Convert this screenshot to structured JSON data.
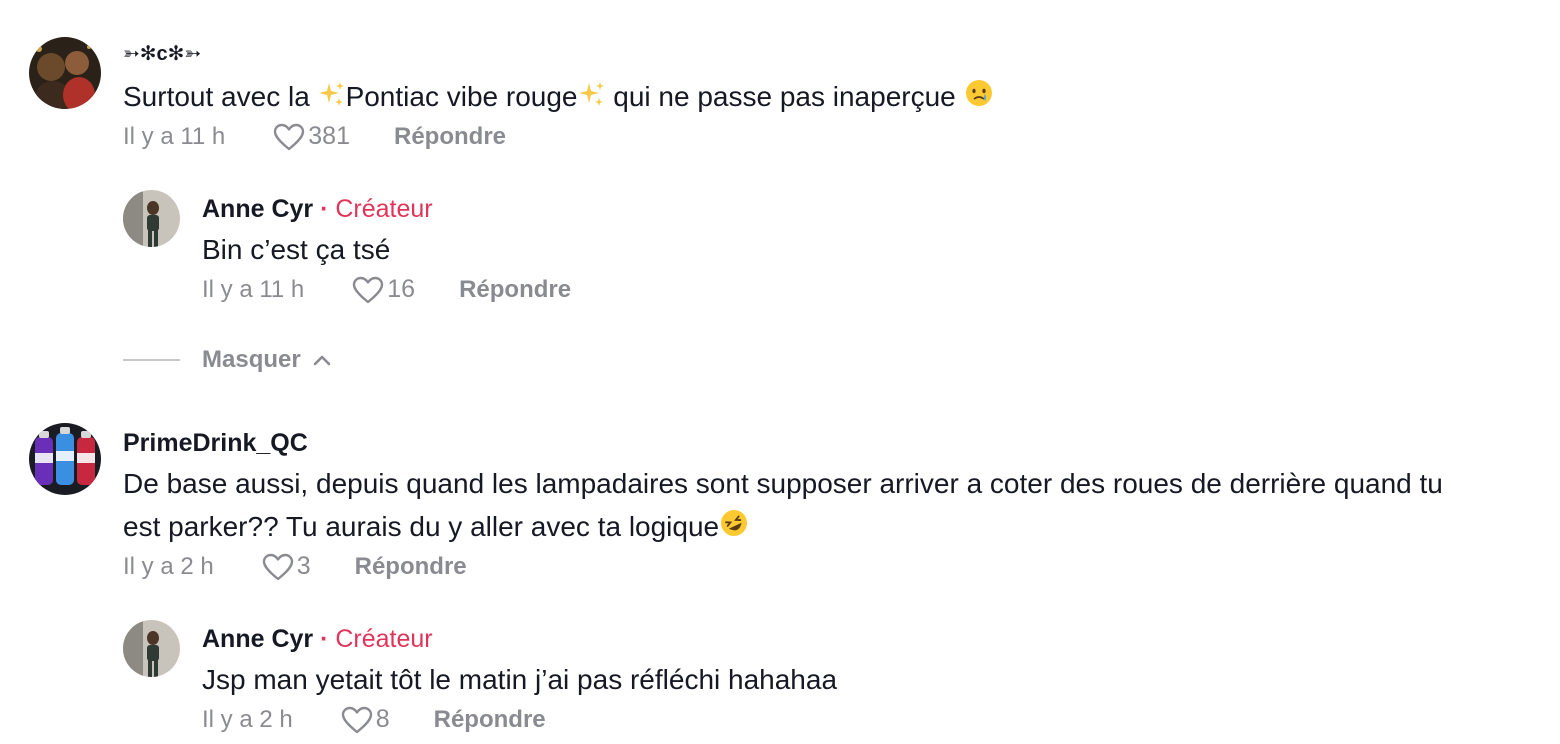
{
  "comments": [
    {
      "username": "➳✻c✻➳",
      "text_before": "Surtout avec la ",
      "text_mid": "Pontiac vibe rouge",
      "text_after": " qui ne passe pas inaperçue ",
      "time": "Il y a 11 h",
      "likes": "381",
      "reply_label": "Répondre",
      "replies": [
        {
          "username": "Anne Cyr",
          "badge": "Créateur",
          "text": "Bin c’est ça tsé",
          "time": "Il y a 11 h",
          "likes": "16",
          "reply_label": "Répondre"
        }
      ],
      "hide_label": "Masquer"
    },
    {
      "username": "PrimeDrink_QC",
      "text_line1": "De base aussi, depuis quand les lampadaires sont supposer arriver a coter des roues de derrière quand tu",
      "text_line2": "est parker?? Tu aurais du y aller avec ta logique",
      "time": "Il y a 2 h",
      "likes": "3",
      "reply_label": "Répondre",
      "replies": [
        {
          "username": "Anne Cyr",
          "badge": "Créateur",
          "text": "Jsp man yetait tôt le matin j’ai pas réfléchi hahahaa",
          "time": "Il y a 2 h",
          "likes": "8",
          "reply_label": "Répondre"
        }
      ]
    }
  ],
  "colors": {
    "creator_badge": "#e0355a",
    "muted_text": "#8a8b91",
    "primary_text": "#161823"
  },
  "icons": [
    "heart-icon",
    "chevron-up-icon",
    "sparkles-emoji",
    "crying-face-emoji",
    "rofl-emoji"
  ]
}
